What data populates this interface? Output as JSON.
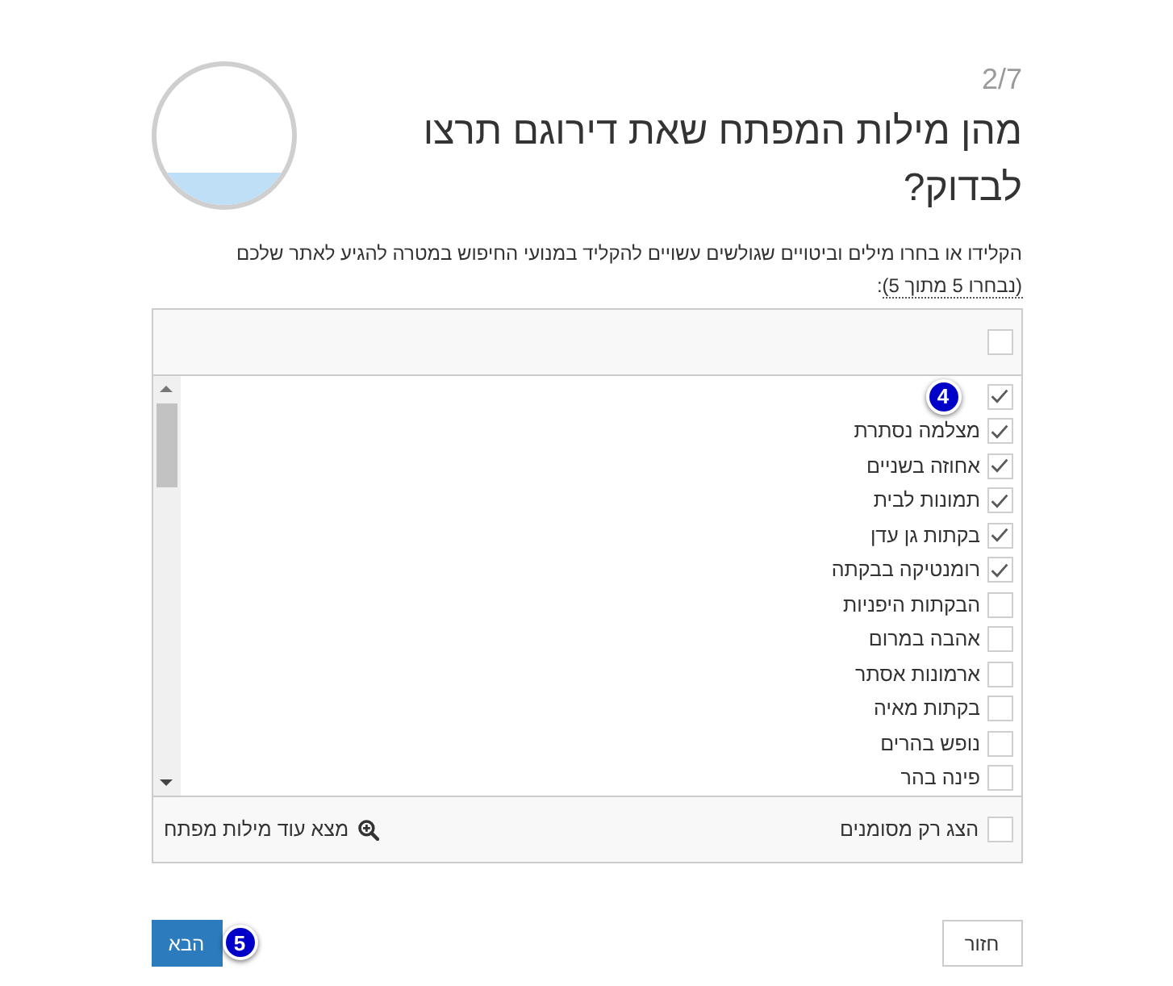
{
  "progress": {
    "step": "2/7",
    "level": 0.22
  },
  "question": {
    "title": "מהן מילות המפתח שאת דירוגם תרצו לבדוק?"
  },
  "instructions": {
    "text": "הקלידו או בחרו מילים וביטויים שגולשים עשויים להקליד במנועי החיפוש במטרה להגיע לאתר שלכם",
    "selection_count": "(נבחרו 5 מתוך 5)",
    "suffix": ":"
  },
  "keyword_list": {
    "select_all": {
      "checked": false
    },
    "items": [
      {
        "checked": true,
        "annotation": "4"
      },
      {
        "label": "מצלמה נסתרת",
        "checked": true
      },
      {
        "label": "אחוזה בשניים",
        "checked": true
      },
      {
        "label": "תמונות לבית",
        "checked": true
      },
      {
        "label": "בקתות גן עדן",
        "checked": true
      },
      {
        "label": "רומנטיקה בבקתה",
        "checked": true
      },
      {
        "label": "הבקתות היפניות",
        "checked": false
      },
      {
        "label": "אהבה במרום",
        "checked": false
      },
      {
        "label": "ארמונות אסתר",
        "checked": false
      },
      {
        "label": "בקתות מאיה",
        "checked": false
      },
      {
        "label": "נופש בהרים",
        "checked": false
      },
      {
        "label": "פינה בהר",
        "checked": false
      }
    ]
  },
  "footer": {
    "show_selected_only": {
      "label": "הצג רק מסומנים",
      "checked": false
    },
    "find_more": {
      "label": "מצא עוד מילות מפתח"
    }
  },
  "buttons": [
    {
      "label": "חזור",
      "kind": "secondary"
    },
    {
      "label": "הבא",
      "kind": "primary",
      "annotation": "5"
    }
  ]
}
